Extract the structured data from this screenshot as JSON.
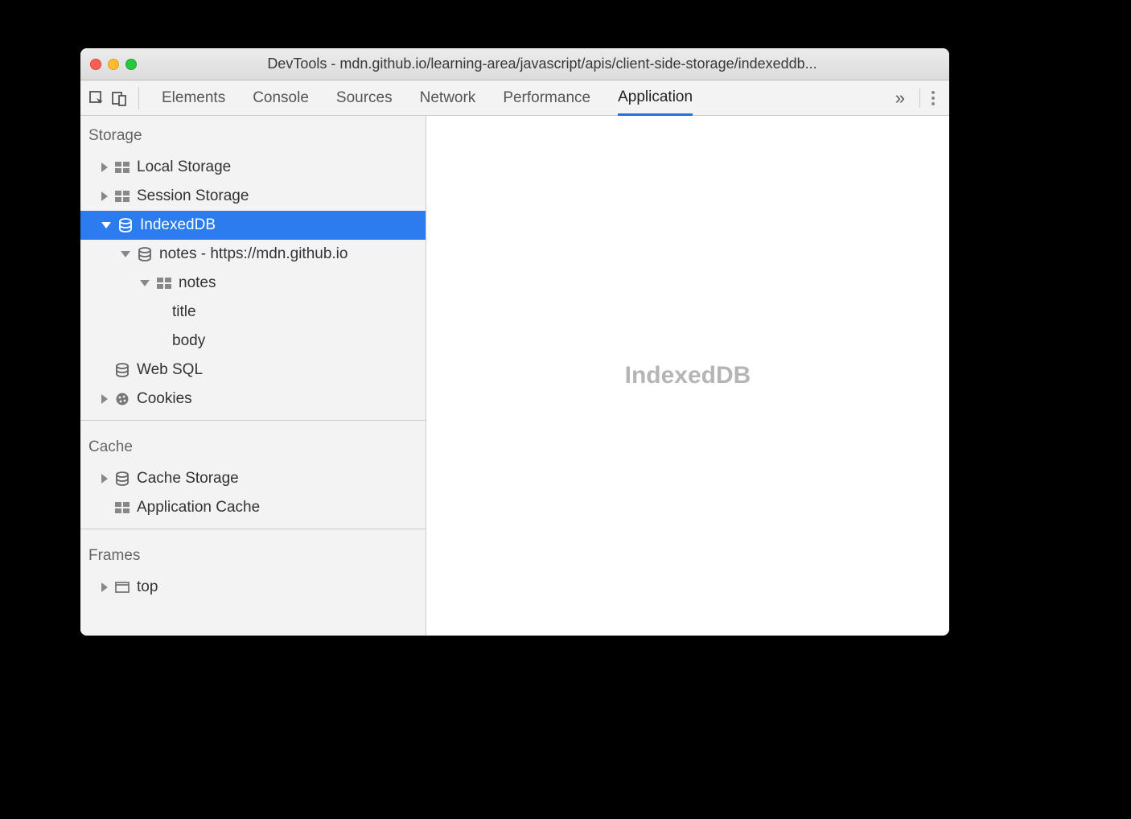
{
  "window": {
    "title": "DevTools - mdn.github.io/learning-area/javascript/apis/client-side-storage/indexeddb..."
  },
  "tabs": {
    "elements": "Elements",
    "console": "Console",
    "sources": "Sources",
    "network": "Network",
    "performance": "Performance",
    "application": "Application"
  },
  "sidebar": {
    "storage_header": "Storage",
    "local_storage": "Local Storage",
    "session_storage": "Session Storage",
    "indexeddb": "IndexedDB",
    "notes_db": "notes - https://mdn.github.io",
    "notes_store": "notes",
    "index_title": "title",
    "index_body": "body",
    "web_sql": "Web SQL",
    "cookies": "Cookies",
    "cache_header": "Cache",
    "cache_storage": "Cache Storage",
    "app_cache": "Application Cache",
    "frames_header": "Frames",
    "frames_top": "top"
  },
  "main": {
    "placeholder": "IndexedDB"
  }
}
